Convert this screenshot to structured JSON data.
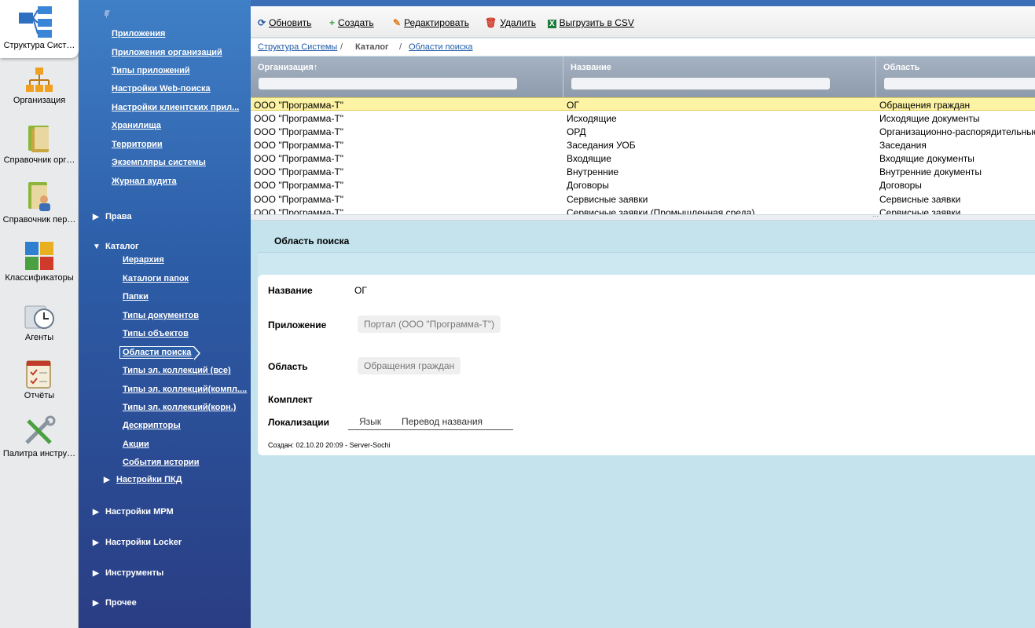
{
  "iconbar": {
    "items": [
      {
        "label": "Структура Сист…",
        "icon": "structure-icon",
        "active": true
      },
      {
        "label": "Организация",
        "icon": "org-tree-icon"
      },
      {
        "label": "Справочник орг…",
        "icon": "folder-book-icon"
      },
      {
        "label": "Справочник пер…",
        "icon": "people-book-icon"
      },
      {
        "label": "Классификаторы",
        "icon": "puzzle-icon"
      },
      {
        "label": "Агенты",
        "icon": "clock-icon"
      },
      {
        "label": "Отчёты",
        "icon": "report-icon"
      },
      {
        "label": "Палитра инстру…",
        "icon": "tools-icon"
      }
    ]
  },
  "nav": {
    "pin_icon": "pin-icon",
    "links_top": [
      "Приложения",
      "Приложения организаций",
      "Типы приложений",
      "Настройки Web-поиска",
      "Настройки клиентских прил...",
      "Хранилища",
      "Территории",
      "Экземпляры системы",
      "Журнал аудита"
    ],
    "section_rights": "Права",
    "section_catalog": "Каталог",
    "catalog_links": [
      "Иерархия",
      "Каталоги папок",
      "Папки",
      "Типы документов",
      "Типы объектов",
      "Области поиска",
      "Типы эл. коллекций (все)",
      "Типы эл. коллекций(компл....",
      "Типы эл. коллекций(корн.)",
      "Дескрипторы",
      "Акции",
      "События истории"
    ],
    "pkd_settings": "Настройки ПКД",
    "sections_bottom": [
      "Настройки МРМ",
      "Настройки Locker",
      "Инструменты",
      "Прочее"
    ]
  },
  "toolbar": {
    "refresh": "Обновить",
    "create": "Создать",
    "edit": "Редактировать",
    "delete": "Удалить",
    "export": "Выгрузить в CSV"
  },
  "breadcrumb": {
    "root": "Структура Системы",
    "sep": "/",
    "middle": "Каталог",
    "current": "Области поиска"
  },
  "grid": {
    "columns": [
      "Организация↑",
      "Название",
      "Область"
    ],
    "rows": [
      [
        "ООО \"Программа-Т\"",
        "ОГ",
        "Обращения граждан"
      ],
      [
        "ООО \"Программа-Т\"",
        "Исходящие",
        "Исходящие документы"
      ],
      [
        "ООО \"Программа-Т\"",
        "ОРД",
        "Организационно-распорядительные"
      ],
      [
        "ООО \"Программа-Т\"",
        "Заседания УОБ",
        "Заседания"
      ],
      [
        "ООО \"Программа-Т\"",
        "Входящие",
        "Входящие документы"
      ],
      [
        "ООО \"Программа-Т\"",
        "Внутренние",
        "Внутренние документы"
      ],
      [
        "ООО \"Программа-Т\"",
        "Договоры",
        "Договоры"
      ],
      [
        "ООО \"Программа-Т\"",
        "Сервисные заявки",
        "Сервисные заявки"
      ],
      [
        "ООО \"Программа-Т\"",
        "Сервисные заявки (Промышленная среда)",
        "Сервисные заявки"
      ]
    ]
  },
  "detail": {
    "title": "Область поиска",
    "name_label": "Название",
    "name_value": "ОГ",
    "app_label": "Приложение",
    "app_value": "Портал (ООО \"Программа-Т\")",
    "area_label": "Область",
    "area_value": "Обращения граждан",
    "set_label": "Комплект",
    "loc_label": "Локализации",
    "loc_tab_lang": "Язык",
    "loc_tab_translation": "Перевод названия",
    "created": "Создан: 02.10.20 20:09 - Server-Sochi"
  }
}
